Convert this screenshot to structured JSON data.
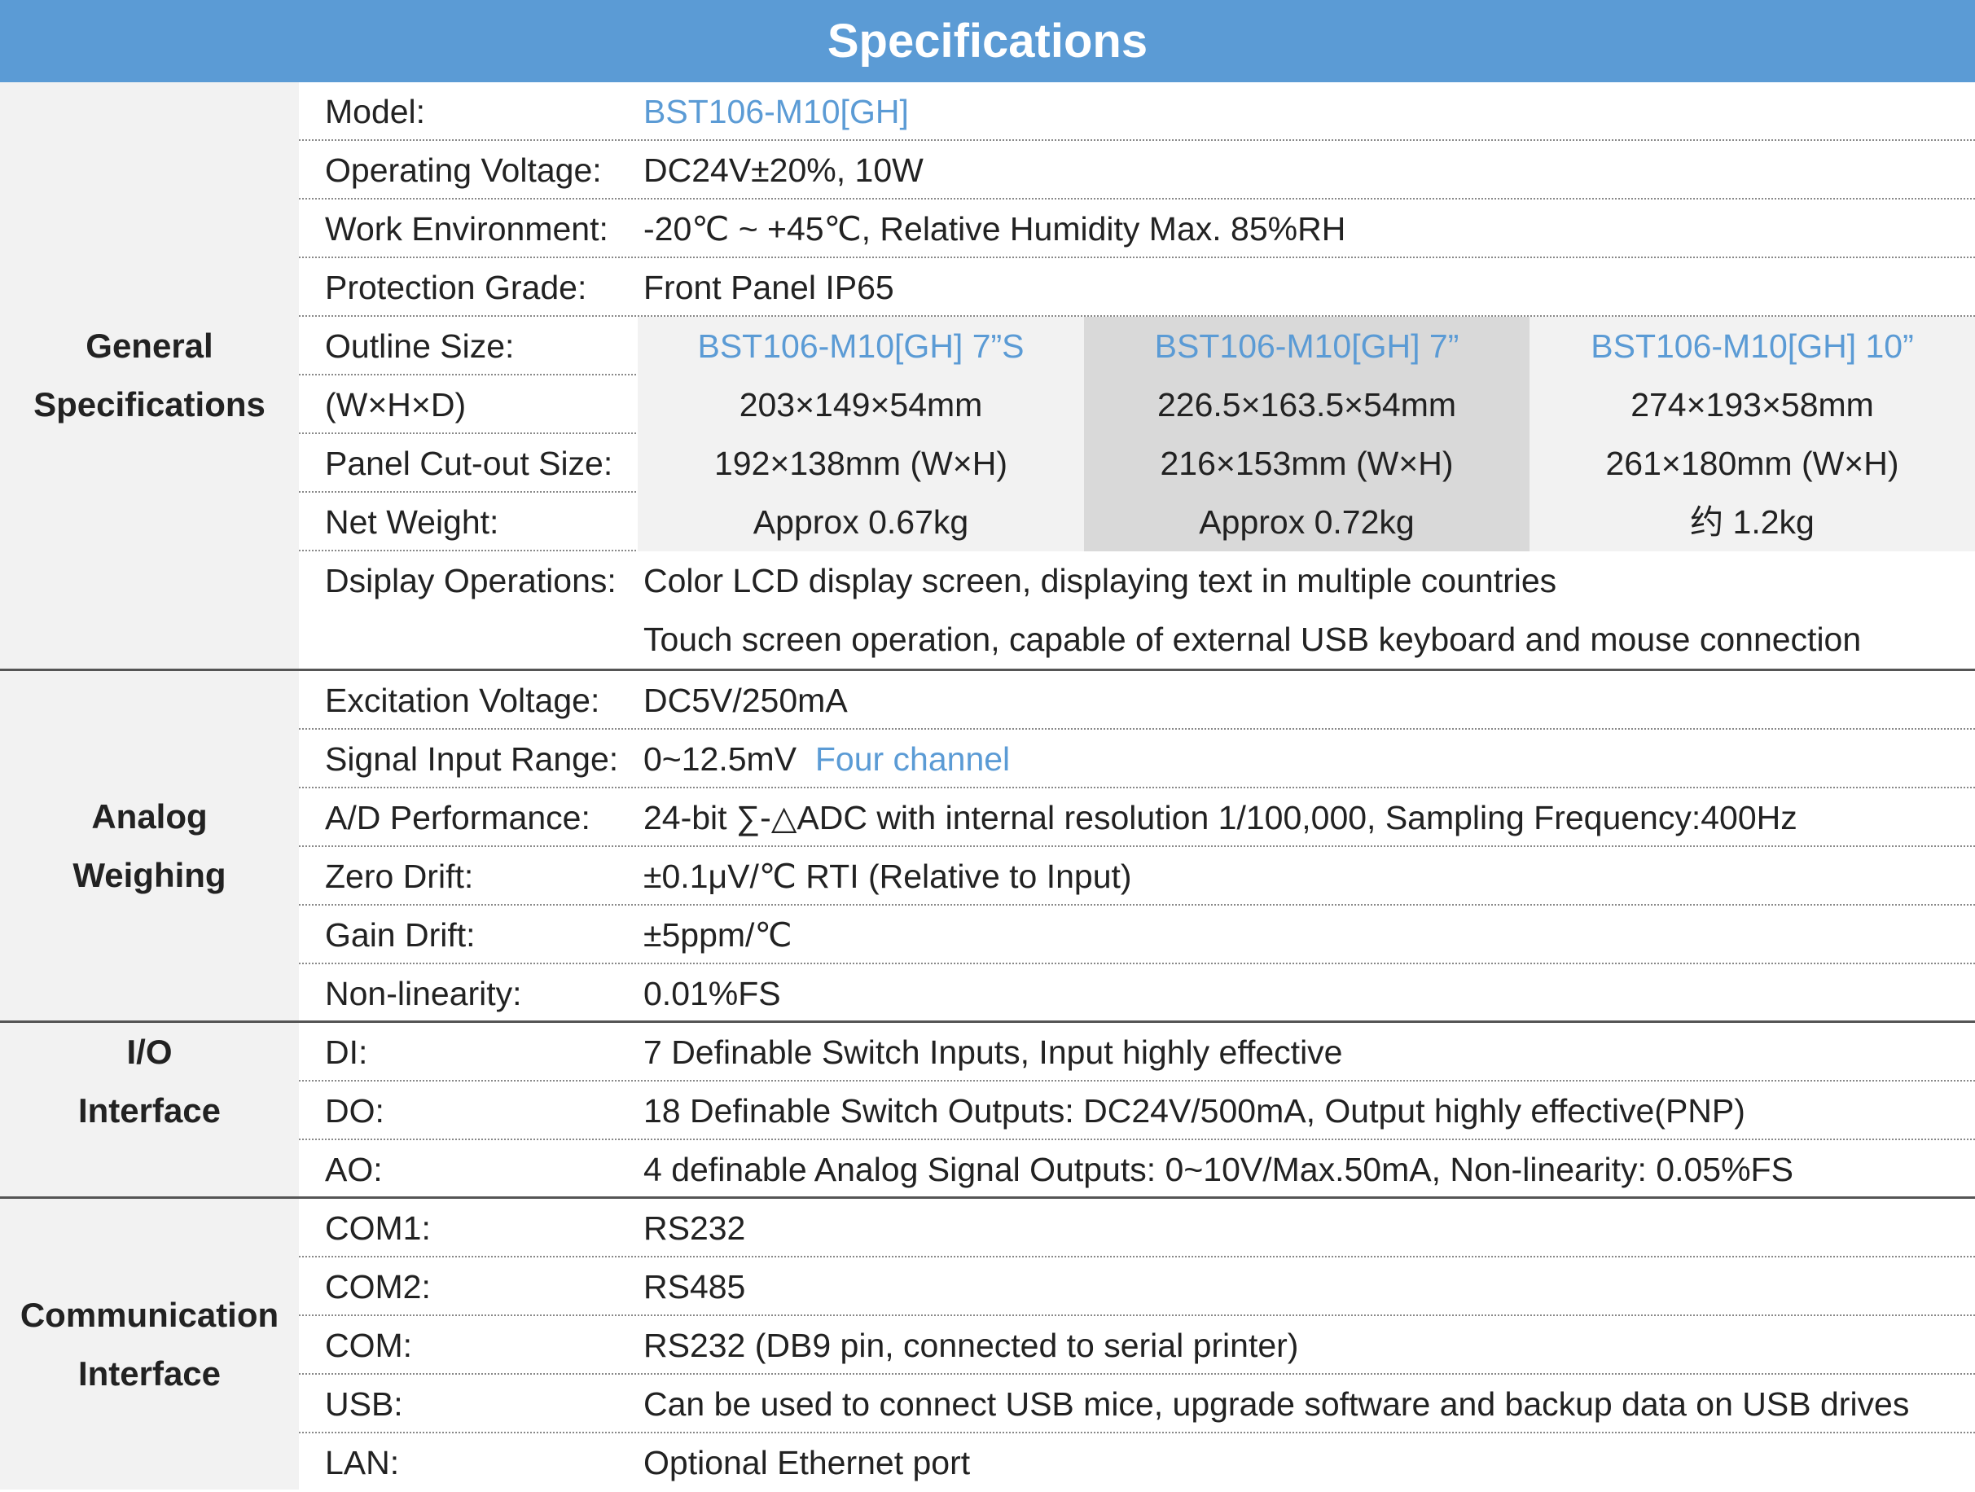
{
  "header": {
    "title": "Specifications"
  },
  "general": {
    "label_line1": "General",
    "label_line2": "Specifications",
    "model_label": "Model:",
    "model_value": "BST106-M10[GH]",
    "voltage_label": "Operating Voltage:",
    "voltage_value": "DC24V±20%, 10W",
    "env_label": "Work Environment:",
    "env_value": "-20℃ ~ +45℃, Relative Humidity Max. 85%RH",
    "protection_label": "Protection Grade:",
    "protection_value": "Front Panel  IP65",
    "outline_label": "Outline Size:",
    "dims_label": "(W×H×D)",
    "cutout_label": "Panel Cut-out Size:",
    "weight_label": "Net Weight:",
    "models": [
      {
        "name": "BST106-M10[GH]  7”S",
        "size": "203×149×54mm",
        "cutout": "192×138mm (W×H)",
        "weight": "Approx  0.67kg"
      },
      {
        "name": "BST106-M10[GH]  7”",
        "size": "226.5×163.5×54mm",
        "cutout": "216×153mm (W×H)",
        "weight": "Approx  0.72kg"
      },
      {
        "name": "BST106-M10[GH]  10”",
        "size": "274×193×58mm",
        "cutout": "261×180mm (W×H)",
        "weight": "约 1.2kg"
      }
    ],
    "display_label": "Dsiplay Operations:",
    "display_value1": "Color LCD display screen, displaying text in multiple countries",
    "display_value2": "Touch screen operation, capable of external USB keyboard and mouse connection"
  },
  "analog": {
    "label_line1": "Analog",
    "label_line2": "Weighing",
    "excitation_label": "Excitation Voltage:",
    "excitation_value": "DC5V/250mA",
    "signal_label": "Signal Input Range:",
    "signal_value": "0~12.5mV",
    "signal_channels": "Four  channel",
    "ad_label": "A/D Performance:",
    "ad_value": "24-bit ∑-△ADC with internal resolution 1/100,000, Sampling Frequency:400Hz",
    "zero_label": "Zero Drift:",
    "zero_value": "±0.1μV/℃ RTI (Relative to Input)",
    "gain_label": "Gain Drift:",
    "gain_value": "±5ppm/℃",
    "nonlin_label": "Non-linearity:",
    "nonlin_value": "0.01%FS"
  },
  "io": {
    "label_line1": "I/O",
    "label_line2": "Interface",
    "di_label": "DI:",
    "di_value": "7 Definable  Switch Inputs, Input highly effective",
    "do_label": "DO:",
    "do_value": "18 Definable  Switch Outputs: DC24V/500mA, Output highly effective(PNP)",
    "ao_label": "AO:",
    "ao_value": "4 definable Analog Signal Outputs: 0~10V/Max.50mA,  Non-linearity: 0.05%FS"
  },
  "comm": {
    "label_line1": "Communication",
    "label_line2": "Interface",
    "com1_label": "COM1:",
    "com1_value": "RS232",
    "com2_label": "COM2:",
    "com2_value": "RS485",
    "com_label": "COM:",
    "com_value": "RS232 (DB9 pin, connected to serial printer)",
    "usb_label": "USB:",
    "usb_value": "Can be used to connect USB mice, upgrade software  and backup data on USB drives",
    "lan_label": "LAN:",
    "lan_value": "Optional Ethernet port"
  }
}
